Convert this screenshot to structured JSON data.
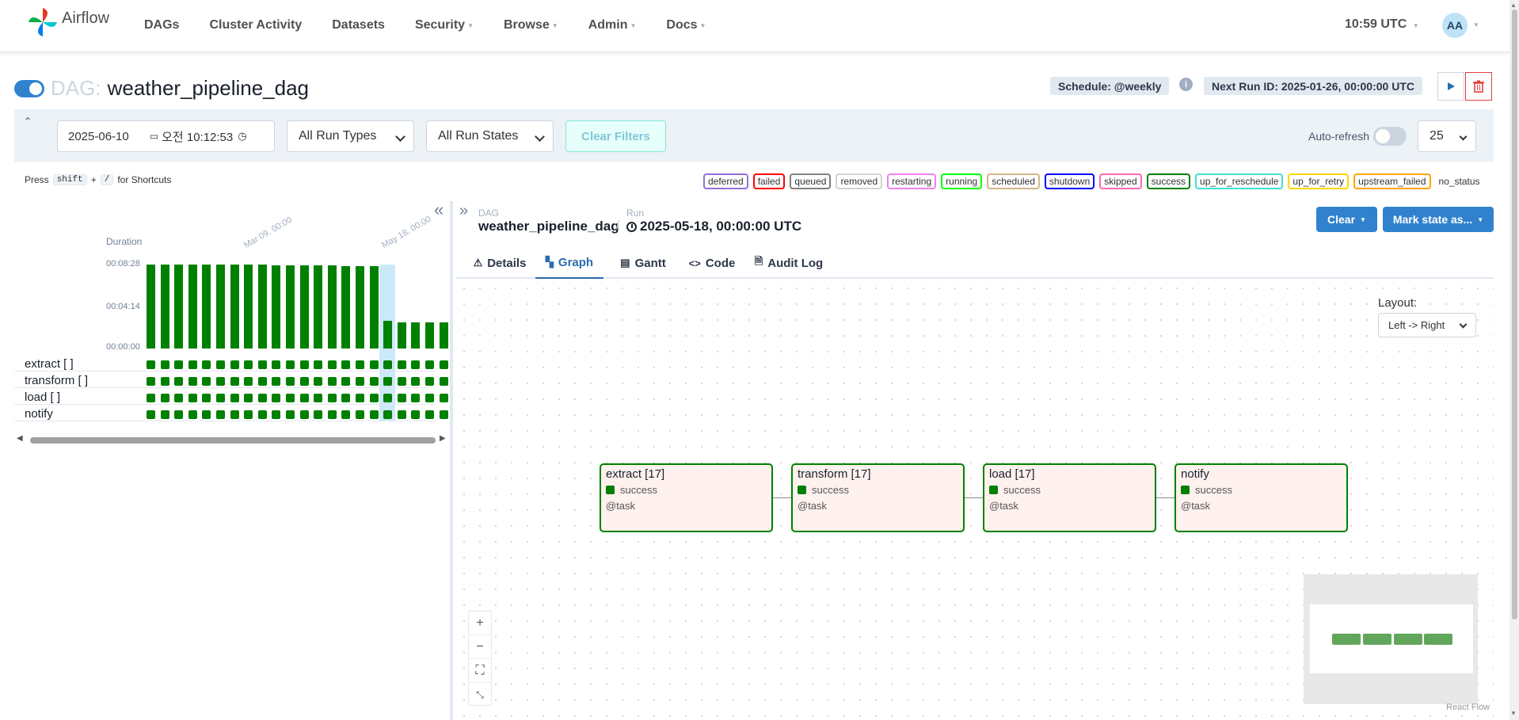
{
  "app": {
    "name": "Airflow"
  },
  "nav": {
    "items": [
      {
        "label": "DAGs",
        "caret": false
      },
      {
        "label": "Cluster Activity",
        "caret": false
      },
      {
        "label": "Datasets",
        "caret": false
      },
      {
        "label": "Security",
        "caret": true
      },
      {
        "label": "Browse",
        "caret": true
      },
      {
        "label": "Admin",
        "caret": true
      },
      {
        "label": "Docs",
        "caret": true
      }
    ],
    "clock": "10:59 UTC",
    "avatar": "AA"
  },
  "dag": {
    "prefix": "DAG:",
    "name": "weather_pipeline_dag",
    "schedule": "Schedule: @weekly",
    "next_run": "Next Run ID: 2025-01-26, 00:00:00 UTC"
  },
  "filters": {
    "date": "2025-06-10",
    "time": "오전 10:12:53",
    "run_types": "All Run Types",
    "run_states": "All Run States",
    "clear_label": "Clear Filters",
    "auto_refresh": "Auto-refresh",
    "count": "25"
  },
  "shortcut": {
    "press": "Press",
    "key1": "shift",
    "plus": "+",
    "key2": "/",
    "suffix": "for Shortcuts"
  },
  "legend": [
    {
      "label": "deferred",
      "color": "#9370db"
    },
    {
      "label": "failed",
      "color": "#ff0000"
    },
    {
      "label": "queued",
      "color": "#808080"
    },
    {
      "label": "removed",
      "color": "#d3d3d3"
    },
    {
      "label": "restarting",
      "color": "#ee82ee"
    },
    {
      "label": "running",
      "color": "#00ff00"
    },
    {
      "label": "scheduled",
      "color": "#d2b48c"
    },
    {
      "label": "shutdown",
      "color": "#0000ff"
    },
    {
      "label": "skipped",
      "color": "#ff69b4"
    },
    {
      "label": "success",
      "color": "#008000"
    },
    {
      "label": "up_for_reschedule",
      "color": "#40e0d0"
    },
    {
      "label": "up_for_retry",
      "color": "#ffd700"
    },
    {
      "label": "upstream_failed",
      "color": "#ffa500"
    },
    {
      "label": "no_status",
      "color": ""
    }
  ],
  "grid": {
    "duration_label": "Duration",
    "ticks": [
      "00:08:28",
      "00:04:14",
      "00:00:00"
    ],
    "date_labels": [
      "Mar 09, 00:00",
      "May 18, 00:00"
    ],
    "run_durations_sec": [
      508,
      508,
      508,
      508,
      506,
      506,
      506,
      506,
      506,
      504,
      504,
      504,
      504,
      504,
      500,
      500,
      500,
      170,
      160,
      160,
      160,
      160
    ],
    "selected_run": 17,
    "tasks": [
      "extract [ ]",
      "transform [ ]",
      "load [ ]",
      "notify"
    ]
  },
  "run": {
    "dag_label": "DAG",
    "run_label": "Run",
    "dag_id": "weather_pipeline_dag",
    "run_id": "2025-05-18, 00:00:00 UTC",
    "clear_btn": "Clear",
    "mark_btn": "Mark state as..."
  },
  "tabs": [
    {
      "label": "Details",
      "icon": "⚠",
      "active": false
    },
    {
      "label": "Graph",
      "icon": "▚",
      "active": true
    },
    {
      "label": "Gantt",
      "icon": "▤",
      "active": false
    },
    {
      "label": "Code",
      "icon": "<>",
      "active": false
    },
    {
      "label": "Audit Log",
      "icon": "🗎",
      "active": false
    }
  ],
  "graph": {
    "layout_label": "Layout:",
    "layout_value": "Left -> Right",
    "nodes": [
      {
        "title": "extract [17]",
        "state": "success",
        "op": "@task"
      },
      {
        "title": "transform [17]",
        "state": "success",
        "op": "@task"
      },
      {
        "title": "load [17]",
        "state": "success",
        "op": "@task"
      },
      {
        "title": "notify",
        "state": "success",
        "op": "@task"
      }
    ],
    "attribution": "React Flow"
  }
}
